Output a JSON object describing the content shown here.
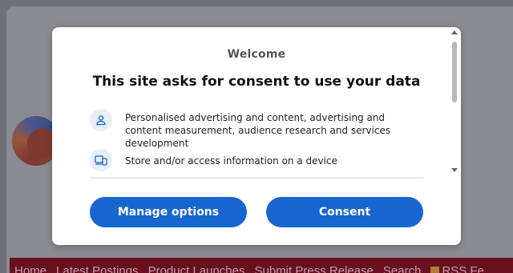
{
  "background_page": {
    "nav_items": [
      "Home",
      "Latest Postings",
      "Product Launches",
      "Submit Press Release",
      "Search",
      "RSS Fe"
    ]
  },
  "dialog": {
    "welcome": "Welcome",
    "headline": "This site asks for consent to use your data",
    "purposes": [
      {
        "icon": "person-icon",
        "text": "Personalised advertising and content, advertising and content measurement, audience research and services development"
      },
      {
        "icon": "devices-icon",
        "text": "Store and/or access information on a device"
      }
    ],
    "buttons": {
      "manage": "Manage options",
      "consent": "Consent"
    },
    "accent_color": "#1766d0"
  }
}
